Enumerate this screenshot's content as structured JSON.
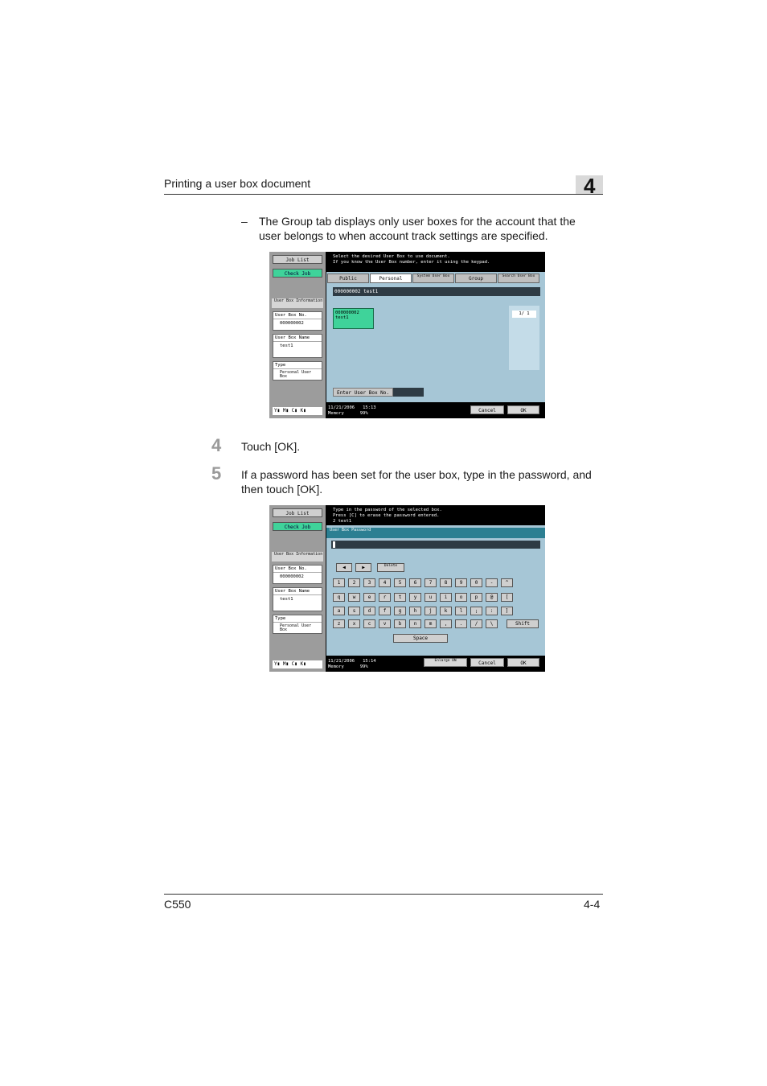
{
  "header": {
    "title": "Printing a user box document",
    "chapter": "4"
  },
  "bullet": {
    "dash": "–",
    "text": "The Group tab displays only user boxes for the account that the user belongs to when account track settings are specified."
  },
  "steps": [
    {
      "num": "4",
      "text": "Touch [OK]."
    },
    {
      "num": "5",
      "text": "If a password has been set for the user box, type in the password, and then touch [OK]."
    }
  ],
  "footer": {
    "model": "C550",
    "page": "4-4"
  },
  "screen1": {
    "side": {
      "job_list": "Job List",
      "check_job": "Check Job",
      "info_header": "User Box Information",
      "box_no_label": "User Box No.",
      "box_no": "000000002",
      "box_name_label": "User Box Name",
      "box_name": "test1",
      "type_label": "Type",
      "type_value": "Personal User Box",
      "toner": "Y▮ M▮ C▮ K▮"
    },
    "message_line1": "Select the desired User Box to use document.",
    "message_line2": "If you know the User Box number, enter it using the keypad.",
    "tabs": [
      "Public",
      "Personal",
      "System User Box",
      "Group",
      "Search User Box"
    ],
    "field": "000000002  test1",
    "box_tile_number": "000000002",
    "box_tile_name": "test1",
    "page_indicator": "1/ 1",
    "enter_no_button": "Enter User Box No.",
    "date": "11/21/2006",
    "time": "15:13",
    "memory_label": "Memory",
    "memory": "99%",
    "cancel": "Cancel",
    "ok": "OK"
  },
  "screen2": {
    "side": {
      "job_list": "Job List",
      "check_job": "Check Job",
      "info_header": "User Box Information",
      "box_no_label": "User Box No.",
      "box_no": "000000002",
      "box_name_label": "User Box Name",
      "box_name": "test1",
      "type_label": "Type",
      "type_value": "Personal User Box",
      "toner": "Y▮ M▮ C▮ K▮"
    },
    "message_line1": "Type in the password of the selected box.",
    "message_line2": "Press [C] to erase the password entered.",
    "message_line3": "2       test1",
    "section_title": "User Box Password",
    "delete_key": "Delete",
    "row1": [
      "1",
      "2",
      "3",
      "4",
      "5",
      "6",
      "7",
      "8",
      "9",
      "0",
      "-",
      "^"
    ],
    "row2": [
      "q",
      "w",
      "e",
      "r",
      "t",
      "y",
      "u",
      "i",
      "o",
      "p",
      "@",
      "["
    ],
    "row3": [
      "a",
      "s",
      "d",
      "f",
      "g",
      "h",
      "j",
      "k",
      "l",
      ";",
      ":",
      "]"
    ],
    "row4": [
      "z",
      "x",
      "c",
      "v",
      "b",
      "n",
      "m",
      ",",
      ".",
      "/",
      "\\"
    ],
    "shift": "Shift",
    "space": "Space",
    "enlarge": "Enlarge ON",
    "date": "11/21/2006",
    "time": "15:14",
    "memory_label": "Memory",
    "memory": "99%",
    "cancel": "Cancel",
    "ok": "OK"
  }
}
